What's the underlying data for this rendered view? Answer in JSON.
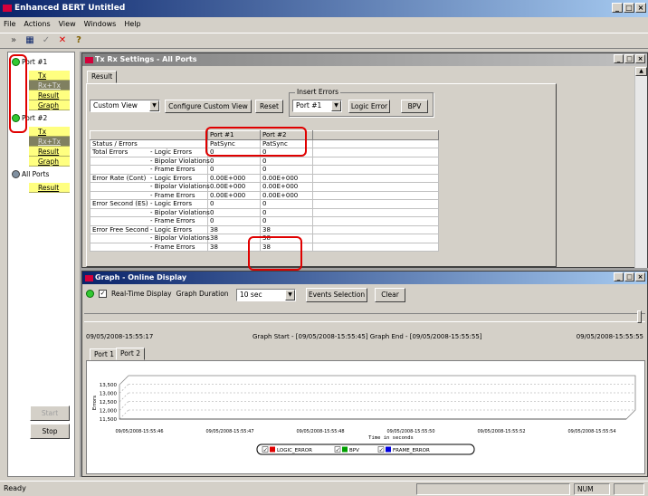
{
  "app": {
    "title": "Enhanced BERT Untitled"
  },
  "menu": [
    "File",
    "Actions",
    "View",
    "Windows",
    "Help"
  ],
  "tree": {
    "port1": {
      "label": "Port #1",
      "items": [
        "Tx",
        "Rx+Tx",
        "Result",
        "Graph"
      ]
    },
    "port2": {
      "label": "Port #2",
      "items": [
        "Tx",
        "Rx+Tx",
        "Result",
        "Graph"
      ]
    },
    "allports": {
      "label": "All Ports",
      "items": [
        "Result"
      ]
    }
  },
  "left_buttons": {
    "start": "Start",
    "stop": "Stop"
  },
  "txrx": {
    "title": "Tx Rx Settings - All Ports",
    "tab": "Result",
    "view_select": "Custom View",
    "configure_btn": "Configure Custom View",
    "reset_btn": "Reset",
    "insert_errors_label": "Insert Errors",
    "port_select": "Port #1",
    "logic_error_btn": "Logic Error",
    "bpv_btn": "BPV",
    "table": {
      "headers": [
        "Port #1",
        "Port #2"
      ],
      "rows": [
        {
          "label": "Status / Errors",
          "sub": "",
          "p1": "PatSync",
          "p2": "PatSync"
        },
        {
          "label": "Total Errors",
          "sub": "- Logic Errors",
          "p1": "0",
          "p2": "0"
        },
        {
          "label": "",
          "sub": "- Bipolar Violations",
          "p1": "0",
          "p2": "0"
        },
        {
          "label": "",
          "sub": "- Frame Errors",
          "p1": "0",
          "p2": "0"
        },
        {
          "label": "Error Rate (Cont)",
          "sub": "- Logic Errors",
          "p1": "0.00E+000",
          "p2": "0.00E+000"
        },
        {
          "label": "",
          "sub": "- Bipolar Violations",
          "p1": "0.00E+000",
          "p2": "0.00E+000"
        },
        {
          "label": "",
          "sub": "- Frame Errors",
          "p1": "0.00E+000",
          "p2": "0.00E+000"
        },
        {
          "label": "Error Second (ES)",
          "sub": "- Logic Errors",
          "p1": "0",
          "p2": "0"
        },
        {
          "label": "",
          "sub": "- Bipolar Violations",
          "p1": "0",
          "p2": "0"
        },
        {
          "label": "",
          "sub": "- Frame Errors",
          "p1": "0",
          "p2": "0"
        },
        {
          "label": "Error Free Second",
          "sub": "- Logic Errors",
          "p1": "38",
          "p2": "38"
        },
        {
          "label": "",
          "sub": "- Bipolar Violations",
          "p1": "38",
          "p2": "38"
        },
        {
          "label": "",
          "sub": "- Frame Errors",
          "p1": "38",
          "p2": "38"
        }
      ]
    }
  },
  "graph": {
    "title": "Graph - Online Display",
    "realtime_label": "Real-Time Display",
    "duration_label": "Graph Duration",
    "duration_value": "10 sec",
    "events_btn": "Events Selection",
    "clear_btn": "Clear",
    "start_time": "09/05/2008-15:55:17",
    "range_text": "Graph Start - [09/05/2008-15:55:45] Graph End - [09/05/2008-15:55:55]",
    "end_time": "09/05/2008-15:55:55",
    "tabs": [
      "Port 1",
      "Port 2"
    ],
    "yticks": [
      "13,500",
      "13,000",
      "12,500",
      "12,000",
      "11,500"
    ],
    "ylabel": "Errors",
    "xticks": [
      "09/05/2008-15:55:46",
      "09/05/2008-15:55:47",
      "09/05/2008-15:55:48",
      "09/05/2008-15:55:50",
      "09/05/2008-15:55:52",
      "09/05/2008-15:55:54"
    ],
    "xlabel": "Time in seconds",
    "legend": [
      {
        "name": "LOGIC_ERROR",
        "color": "#e00000"
      },
      {
        "name": "BPV",
        "color": "#00a000"
      },
      {
        "name": "FRAME_ERROR",
        "color": "#0000e0"
      }
    ]
  },
  "status": {
    "left": "Ready",
    "num": "NUM"
  }
}
